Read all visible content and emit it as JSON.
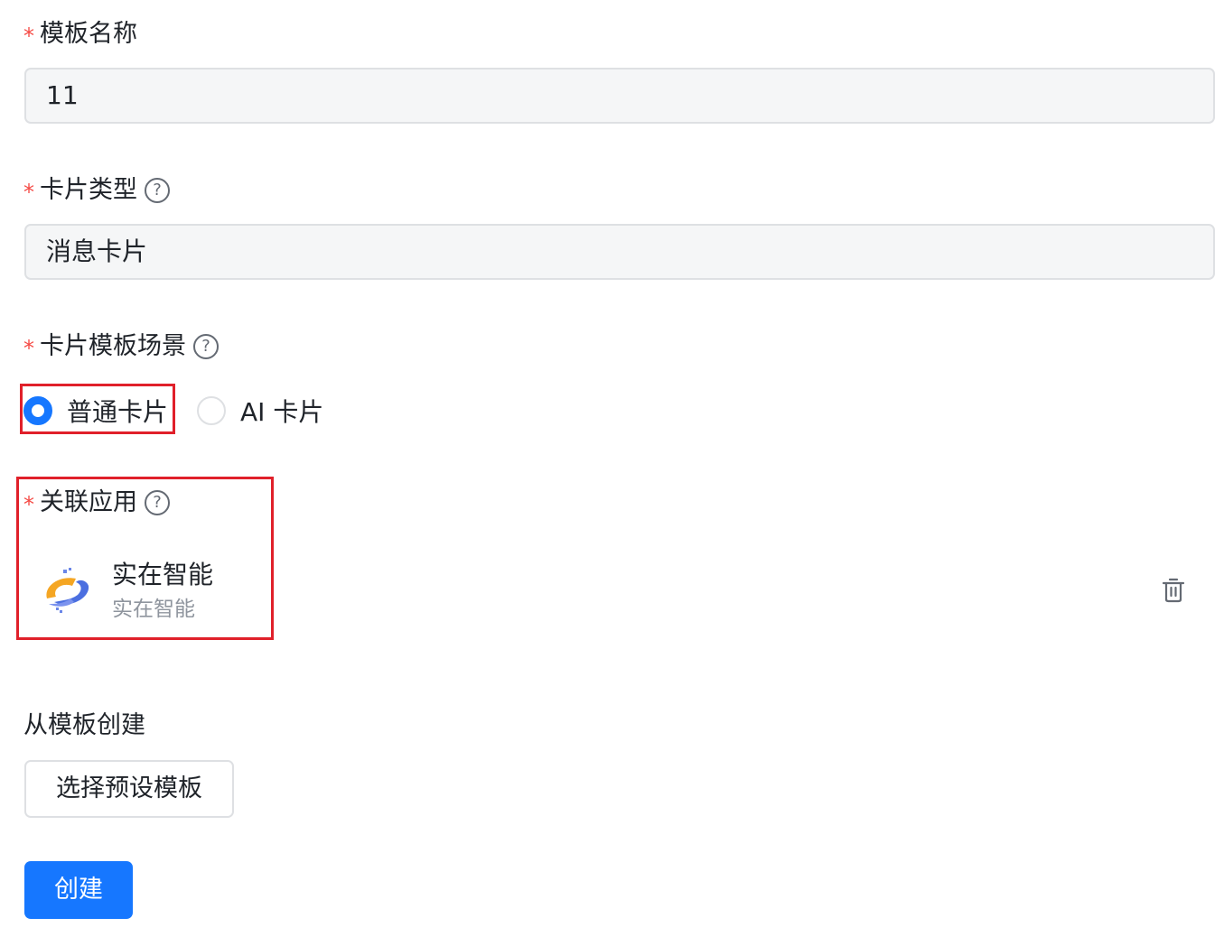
{
  "fields": {
    "template_name": {
      "required_mark": "*",
      "label": "模板名称",
      "value": "11"
    },
    "card_type": {
      "required_mark": "*",
      "label": "卡片类型",
      "help": "?",
      "value": "消息卡片"
    },
    "card_scene": {
      "required_mark": "*",
      "label": "卡片模板场景",
      "help": "?",
      "options": [
        {
          "label": "普通卡片",
          "checked": true
        },
        {
          "label": "AI 卡片",
          "checked": false
        }
      ]
    },
    "linked_app": {
      "required_mark": "*",
      "label": "关联应用",
      "help": "?",
      "app": {
        "name": "实在智能",
        "subtitle": "实在智能",
        "logo_icon": "app-logo"
      },
      "delete_icon": "trash-icon"
    }
  },
  "from_template": {
    "title": "从模板创建",
    "button_label": "选择预设模板"
  },
  "submit": {
    "label": "创建"
  },
  "colors": {
    "primary": "#1677ff",
    "required": "#f54a45",
    "highlight": "#e0202a",
    "input_bg": "#f5f6f7",
    "border": "#dee0e3"
  }
}
